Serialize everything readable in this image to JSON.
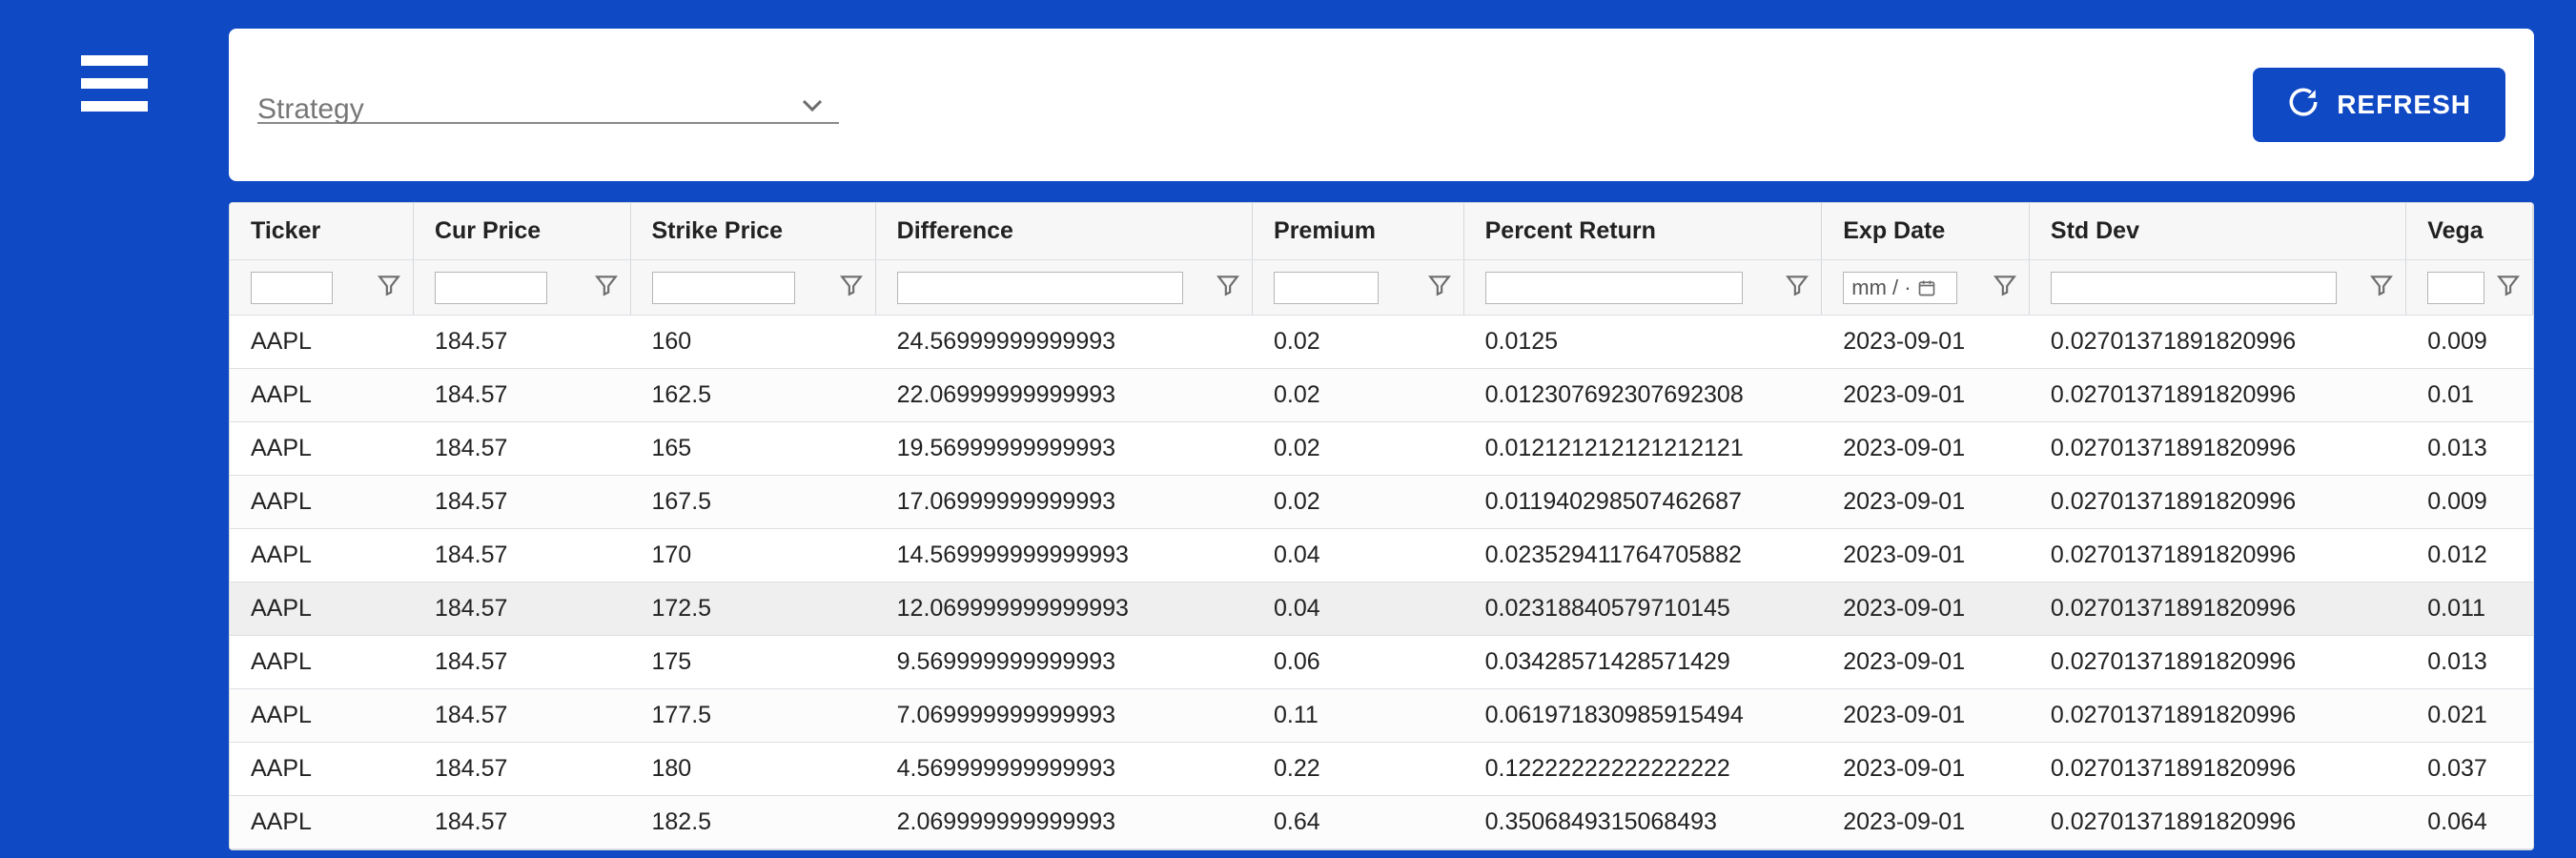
{
  "toolbar": {
    "strategy_label": "Strategy",
    "refresh_label": "REFRESH"
  },
  "date_filter_placeholder": "mm / ·",
  "columns": [
    "Ticker",
    "Cur Price",
    "Strike Price",
    "Difference",
    "Premium",
    "Percent Return",
    "Exp Date",
    "Std Dev",
    "Vega"
  ],
  "rows": [
    {
      "ticker": "AAPL",
      "cur": "184.57",
      "strike": "160",
      "diff": "24.56999999999993",
      "prem": "0.02",
      "pct": "0.0125",
      "exp": "2023-09-01",
      "sd": "0.02701371891820996",
      "vega": "0.009"
    },
    {
      "ticker": "AAPL",
      "cur": "184.57",
      "strike": "162.5",
      "diff": "22.06999999999993",
      "prem": "0.02",
      "pct": "0.012307692307692308",
      "exp": "2023-09-01",
      "sd": "0.02701371891820996",
      "vega": "0.01"
    },
    {
      "ticker": "AAPL",
      "cur": "184.57",
      "strike": "165",
      "diff": "19.56999999999993",
      "prem": "0.02",
      "pct": "0.012121212121212121",
      "exp": "2023-09-01",
      "sd": "0.02701371891820996",
      "vega": "0.013"
    },
    {
      "ticker": "AAPL",
      "cur": "184.57",
      "strike": "167.5",
      "diff": "17.06999999999993",
      "prem": "0.02",
      "pct": "0.011940298507462687",
      "exp": "2023-09-01",
      "sd": "0.02701371891820996",
      "vega": "0.009"
    },
    {
      "ticker": "AAPL",
      "cur": "184.57",
      "strike": "170",
      "diff": "14.569999999999993",
      "prem": "0.04",
      "pct": "0.023529411764705882",
      "exp": "2023-09-01",
      "sd": "0.02701371891820996",
      "vega": "0.012"
    },
    {
      "ticker": "AAPL",
      "cur": "184.57",
      "strike": "172.5",
      "diff": "12.069999999999993",
      "prem": "0.04",
      "pct": "0.02318840579710145",
      "exp": "2023-09-01",
      "sd": "0.02701371891820996",
      "vega": "0.011"
    },
    {
      "ticker": "AAPL",
      "cur": "184.57",
      "strike": "175",
      "diff": "9.569999999999993",
      "prem": "0.06",
      "pct": "0.03428571428571429",
      "exp": "2023-09-01",
      "sd": "0.02701371891820996",
      "vega": "0.013"
    },
    {
      "ticker": "AAPL",
      "cur": "184.57",
      "strike": "177.5",
      "diff": "7.069999999999993",
      "prem": "0.11",
      "pct": "0.061971830985915494",
      "exp": "2023-09-01",
      "sd": "0.02701371891820996",
      "vega": "0.021"
    },
    {
      "ticker": "AAPL",
      "cur": "184.57",
      "strike": "180",
      "diff": "4.569999999999993",
      "prem": "0.22",
      "pct": "0.12222222222222222",
      "exp": "2023-09-01",
      "sd": "0.02701371891820996",
      "vega": "0.037"
    },
    {
      "ticker": "AAPL",
      "cur": "184.57",
      "strike": "182.5",
      "diff": "2.069999999999993",
      "prem": "0.64",
      "pct": "0.3506849315068493",
      "exp": "2023-09-01",
      "sd": "0.02701371891820996",
      "vega": "0.064"
    }
  ],
  "hover_row_index": 5
}
